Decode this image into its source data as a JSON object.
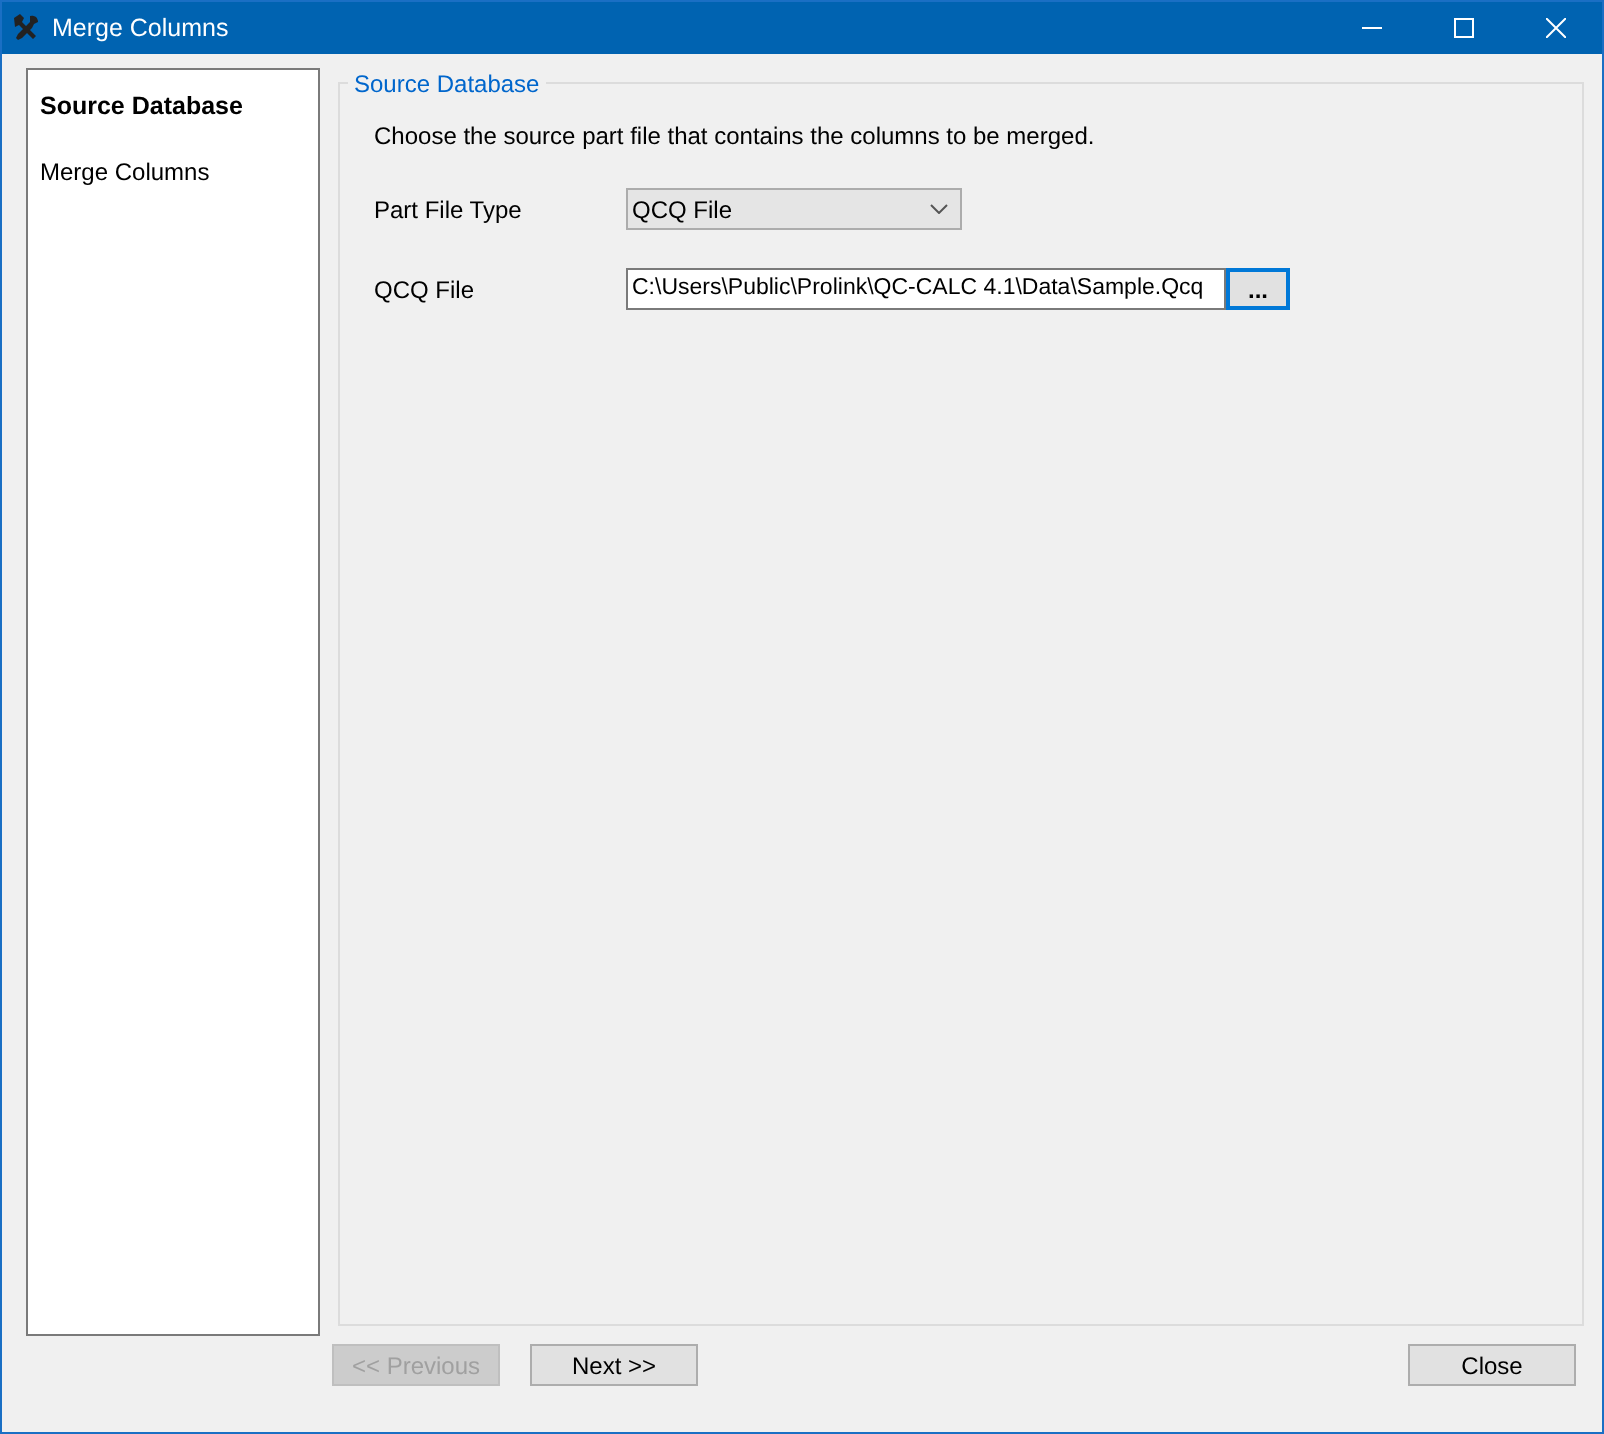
{
  "window": {
    "title": "Merge Columns"
  },
  "steps": [
    {
      "label": "Source Database",
      "selected": true
    },
    {
      "label": "Merge Columns",
      "selected": false
    }
  ],
  "group": {
    "title": "Source Database",
    "instruction": "Choose the source part file that contains the columns to be merged.",
    "part_file_type": {
      "label": "Part File Type",
      "value": "QCQ File"
    },
    "qcq_file": {
      "label": "QCQ File",
      "value": "C:\\Users\\Public\\Prolink\\QC-CALC 4.1\\Data\\Sample.Qcq",
      "browse": "..."
    }
  },
  "buttons": [
    {
      "label": "<< Previous",
      "disabled": true
    },
    {
      "label": "Next >>",
      "disabled": false
    },
    {
      "label": "Close",
      "disabled": false
    }
  ]
}
